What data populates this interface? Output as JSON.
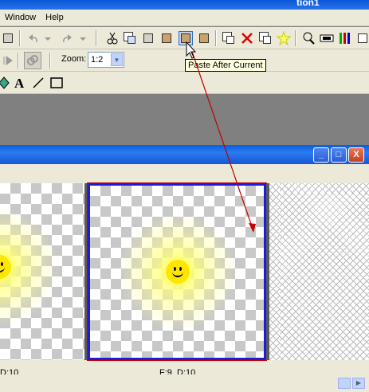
{
  "window": {
    "title_fragment": "tion1"
  },
  "menubar": {
    "items": [
      "Window",
      "Help"
    ]
  },
  "toolbar2": {
    "zoom_label": "Zoom:",
    "zoom_value": "1:2"
  },
  "tooltip": {
    "text": "Paste After Current"
  },
  "child_window": {
    "buttons": {
      "minimize": "_",
      "maximize": "□",
      "close": "X"
    }
  },
  "frames": [
    {
      "label": "D:10"
    },
    {
      "label": "F:9  D:10"
    }
  ],
  "colors": {
    "selection_border": "#1d1dd8",
    "annotation_arrow": "#c00000",
    "titlebar": "#0a58d8"
  },
  "icons": [
    "new-icon",
    "undo-icon",
    "undo-dropdown-icon",
    "redo-icon",
    "redo-dropdown-icon",
    "cut-icon",
    "copy-icon",
    "copy-frames-icon",
    "paste-icon",
    "paste-after-current-icon",
    "paste-before-icon",
    "frame-edit-icon",
    "delete-frame-icon",
    "frame-duplicate-icon",
    "star-icon",
    "magnify-icon",
    "frame-view-icon",
    "color-bars-icon",
    "play-icon",
    "link-icon",
    "fill-icon",
    "text-icon",
    "line-icon",
    "rectangle-icon"
  ]
}
